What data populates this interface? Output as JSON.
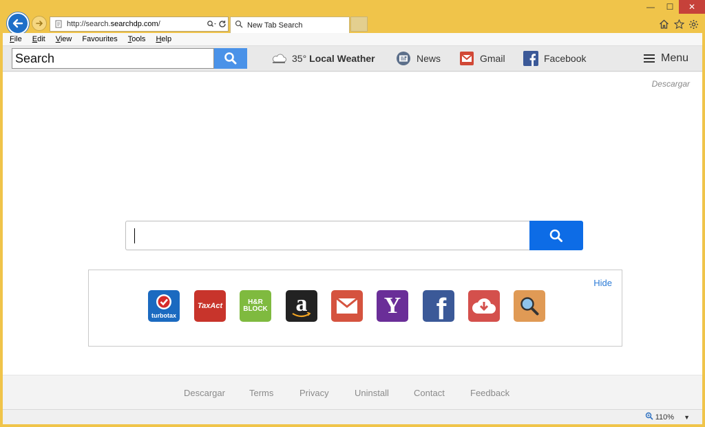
{
  "browser": {
    "url_prefix": "http://search.",
    "url_domain": "searchdp.com",
    "url_suffix": "/",
    "tab_title": "New Tab Search",
    "window": {
      "minimize": "—",
      "maximize": "☐",
      "close": "✕"
    }
  },
  "menubar": {
    "items": [
      {
        "key": "F",
        "rest": "ile"
      },
      {
        "key": "E",
        "rest": "dit"
      },
      {
        "key": "V",
        "rest": "iew"
      },
      {
        "key": "F",
        "rest": "avourites",
        "alt": "a"
      },
      {
        "key": "T",
        "rest": "ools"
      },
      {
        "key": "H",
        "rest": "elp"
      }
    ]
  },
  "toolbar": {
    "search_value": "Search",
    "weather_temp": "35°",
    "weather_label": "Local Weather",
    "news": "News",
    "gmail": "Gmail",
    "facebook": "Facebook",
    "menu": "Menu"
  },
  "page": {
    "descargar_top": "Descargar",
    "hide": "Hide",
    "tiles": [
      {
        "name": "turbotax",
        "label": "turbotax",
        "color": "#1b6ac0"
      },
      {
        "name": "taxact",
        "label": "TaxAct",
        "color": "#c8342b"
      },
      {
        "name": "hrblock",
        "label": "H&R BLOCK",
        "color": "#7fba3f"
      },
      {
        "name": "amazon",
        "label": "a",
        "color": "#222222"
      },
      {
        "name": "gmail",
        "label": "",
        "color": "#d5533f"
      },
      {
        "name": "yahoo",
        "label": "Y",
        "color": "#6a2e98"
      },
      {
        "name": "facebook",
        "label": "f",
        "color": "#3b5998"
      },
      {
        "name": "download",
        "label": "",
        "color": "#d4504c"
      },
      {
        "name": "search",
        "label": "",
        "color": "#e09a55"
      }
    ]
  },
  "footer": {
    "links": [
      "Descargar",
      "Terms",
      "Privacy",
      "Uninstall",
      "Contact",
      "Feedback"
    ]
  },
  "statusbar": {
    "zoom": "110%"
  },
  "colors": {
    "accent": "#0d6ce6",
    "frame": "#f0c44a"
  }
}
